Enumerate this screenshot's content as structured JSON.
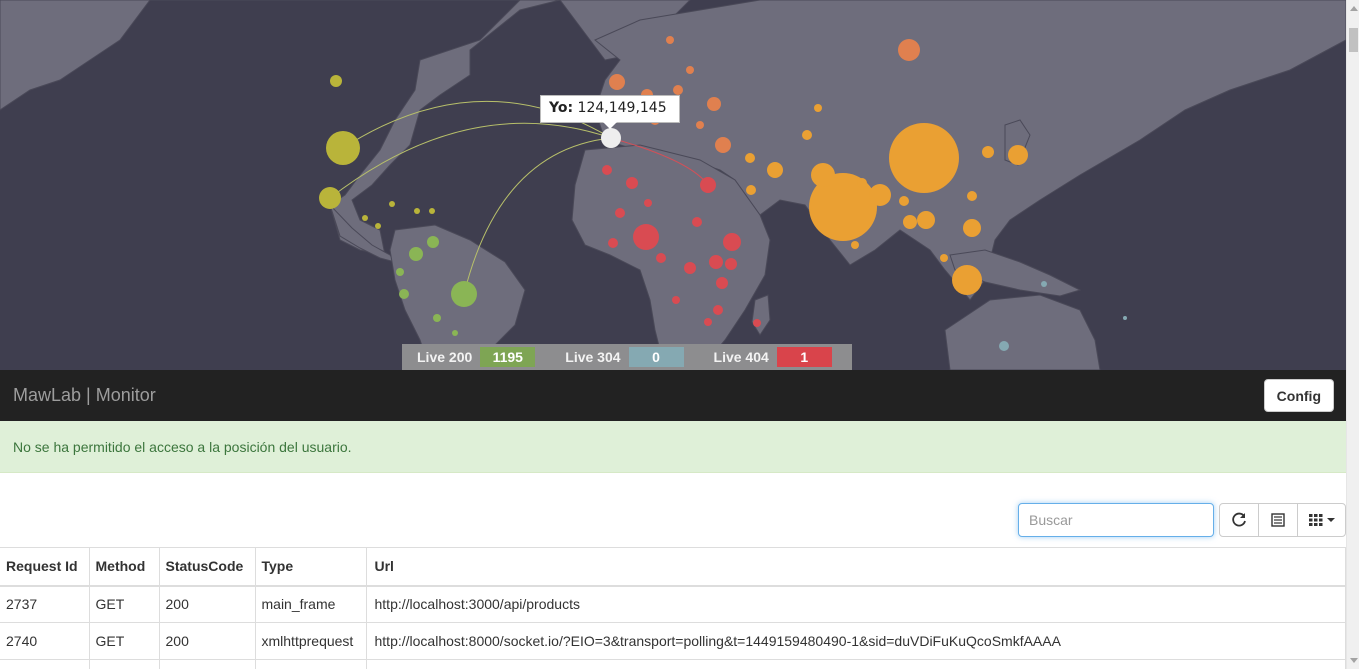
{
  "map": {
    "tooltip": {
      "label": "Yo",
      "value": "124,149,145"
    },
    "colors": {
      "ocean": "#3f3e4f",
      "land": "#6e6d7c",
      "border": "#4a4958",
      "arc_green": "#b8c06a",
      "arc_red": "#d35058",
      "me": "#eeeeee"
    }
  },
  "stats": [
    {
      "label": "Live 200",
      "value": "1195",
      "color": "#7ea554"
    },
    {
      "label": "Live 304",
      "value": "0",
      "color": "#85a9b2"
    },
    {
      "label": "Live 404",
      "value": "1",
      "color": "#d9444b"
    }
  ],
  "navbar": {
    "brand": "MawLab | Monitor",
    "config_label": "Config"
  },
  "alert": {
    "text": "No se ha permitido el acceso a la posición del usuario."
  },
  "toolbar": {
    "search_placeholder": "Buscar",
    "refresh_icon": "refresh-icon",
    "toggle_icon": "list-icon",
    "columns_icon": "grid-icon"
  },
  "table": {
    "columns": [
      "Request Id",
      "Method",
      "StatusCode",
      "Type",
      "Url"
    ],
    "rows": [
      [
        "2737",
        "GET",
        "200",
        "main_frame",
        "http://localhost:3000/api/products"
      ],
      [
        "2740",
        "GET",
        "200",
        "xmlhttprequest",
        "http://localhost:8000/socket.io/?EIO=3&transport=polling&t=1449159480490-1&sid=duVDiFuKuQcoSmkfAAAA"
      ]
    ]
  }
}
